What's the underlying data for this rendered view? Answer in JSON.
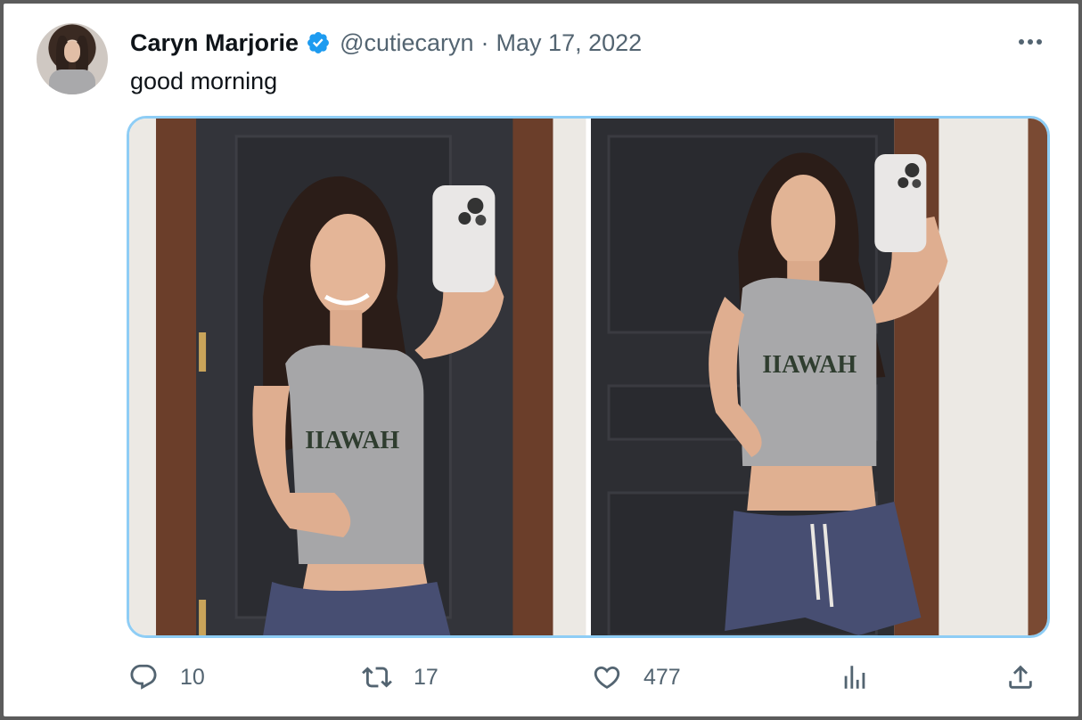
{
  "tweet": {
    "author_name": "Caryn Marjorie",
    "handle": "@cutiecaryn",
    "separator": "·",
    "date": "May 17, 2022",
    "text": "good morning",
    "verified": true
  },
  "media": {
    "photos": [
      {
        "shirt_text": "IIAWAH"
      },
      {
        "shirt_text": "IIAWAH"
      }
    ],
    "border_color": "#8ecdf5"
  },
  "actions": {
    "reply_count": "10",
    "retweet_count": "17",
    "like_count": "477"
  },
  "icons": {
    "reply": "reply-icon",
    "retweet": "retweet-icon",
    "like": "heart-icon",
    "analytics": "analytics-icon",
    "share": "share-icon",
    "more": "more-icon"
  },
  "colors": {
    "text": "#0f1419",
    "muted": "#536471",
    "verified": "#1d9bf0"
  }
}
